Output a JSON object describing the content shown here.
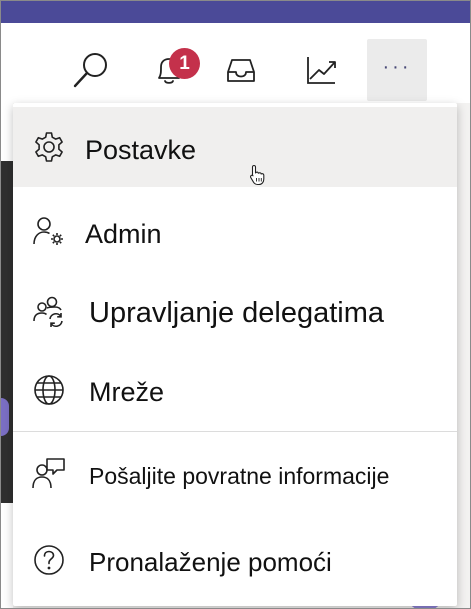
{
  "header": {
    "notification_count": "1",
    "more_label": "···",
    "icons": [
      "search-icon",
      "bell-icon",
      "inbox-icon",
      "activity-chart-icon",
      "more-icon"
    ]
  },
  "menu": {
    "items": [
      {
        "label": "Postavke",
        "icon": "gear-icon"
      },
      {
        "label": "Admin",
        "icon": "person-gear-icon"
      },
      {
        "label": "Upravljanje delegatima",
        "icon": "people-sync-icon"
      },
      {
        "label": "Mreže",
        "icon": "globe-icon"
      },
      {
        "label": "Pošaljite povratne informacije",
        "icon": "feedback-icon"
      },
      {
        "label": "Pronalaženje pomoći",
        "icon": "help-icon"
      }
    ]
  },
  "colors": {
    "top_strip": "#4b4a98",
    "badge": "#c4314b",
    "hover_bg": "#f0efee",
    "accent": "#464775"
  }
}
